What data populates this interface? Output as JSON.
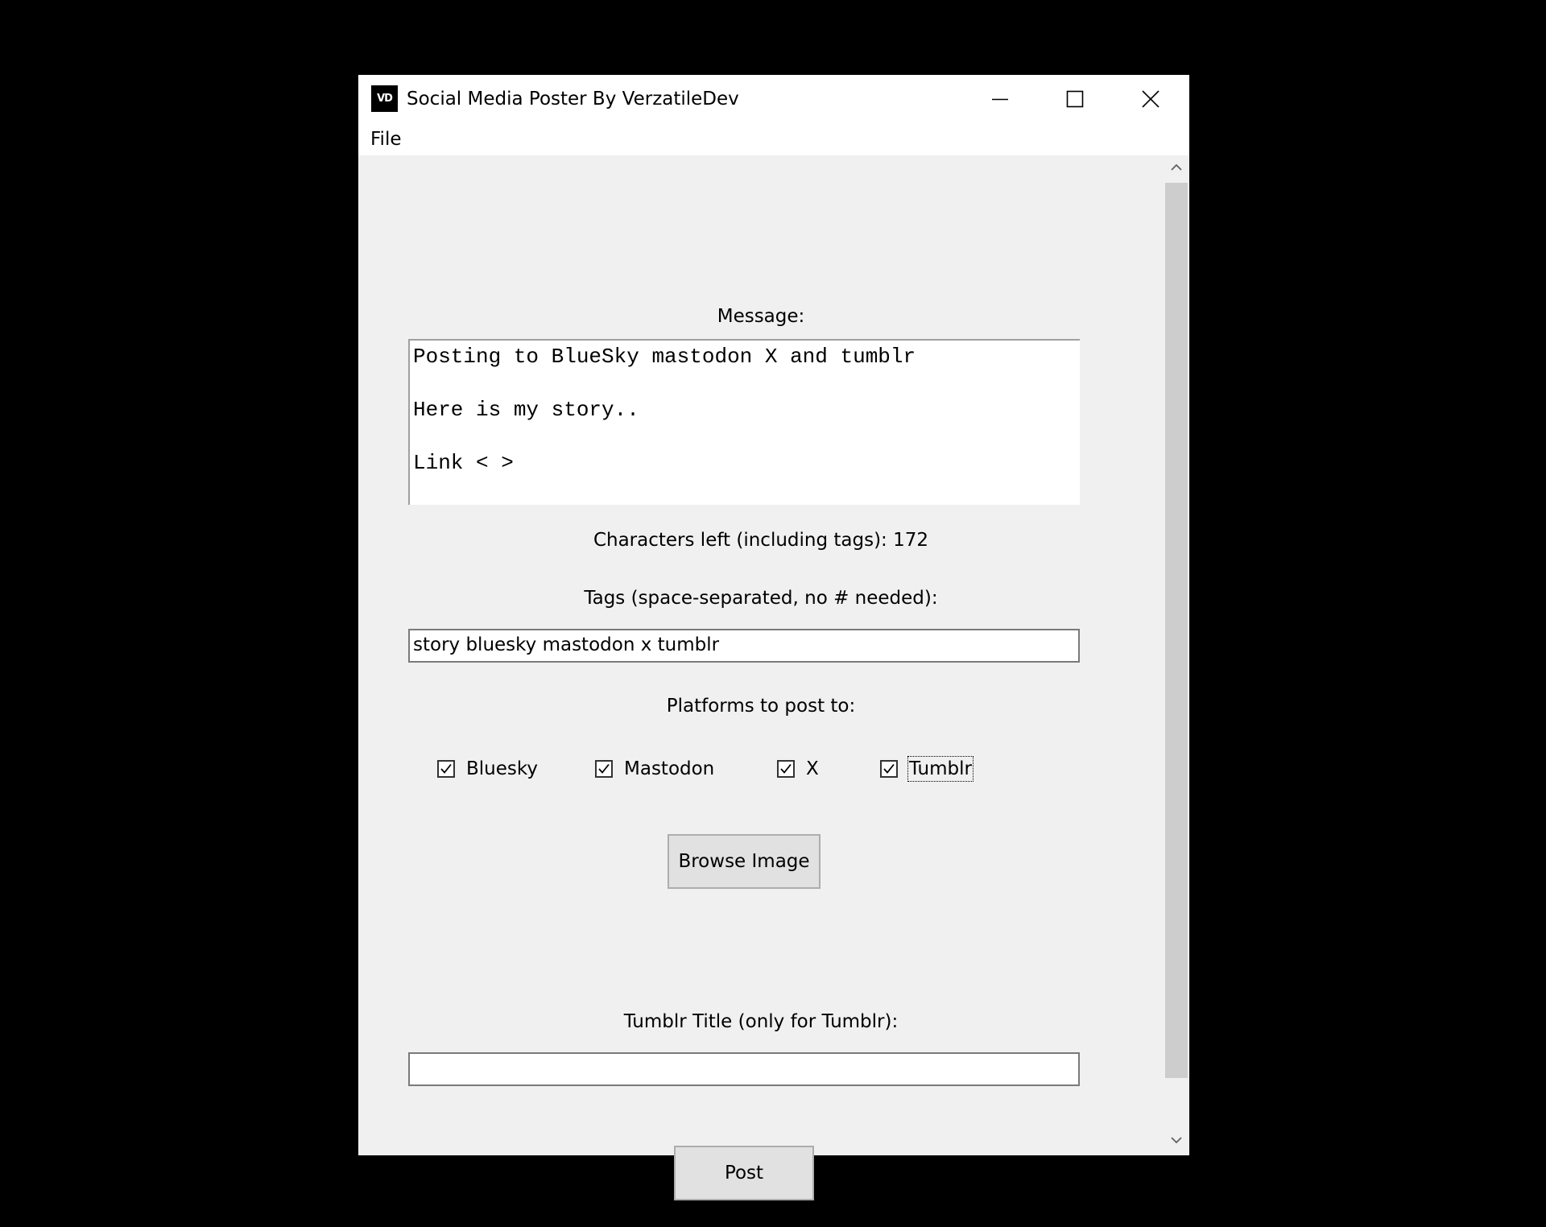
{
  "window": {
    "icon_text": "VD",
    "title": "Social Media Poster By VerzatileDev"
  },
  "menu": {
    "file": "File"
  },
  "form": {
    "message_label": "Message:",
    "message_value": "Posting to BlueSky mastodon X and tumblr\n\nHere is my story..\n\nLink < >",
    "characters_left": "Characters left (including tags): 172",
    "tags_label": "Tags (space-separated, no # needed):",
    "tags_value": "story bluesky mastodon x tumblr",
    "platforms_label": "Platforms to post to:",
    "platforms": [
      {
        "label": "Bluesky",
        "checked": true
      },
      {
        "label": "Mastodon",
        "checked": true
      },
      {
        "label": "X",
        "checked": true
      },
      {
        "label": "Tumblr",
        "checked": true
      }
    ],
    "browse_button": "Browse Image",
    "tumblr_title_label": "Tumblr Title (only for Tumblr):",
    "tumblr_title_value": "",
    "post_button": "Post"
  },
  "icons": {
    "minimize": "minimize-icon",
    "maximize": "maximize-icon",
    "close": "close-icon",
    "scroll_up": "chevron-up-icon",
    "scroll_down": "chevron-down-icon",
    "checkmark": "checkmark-icon"
  }
}
